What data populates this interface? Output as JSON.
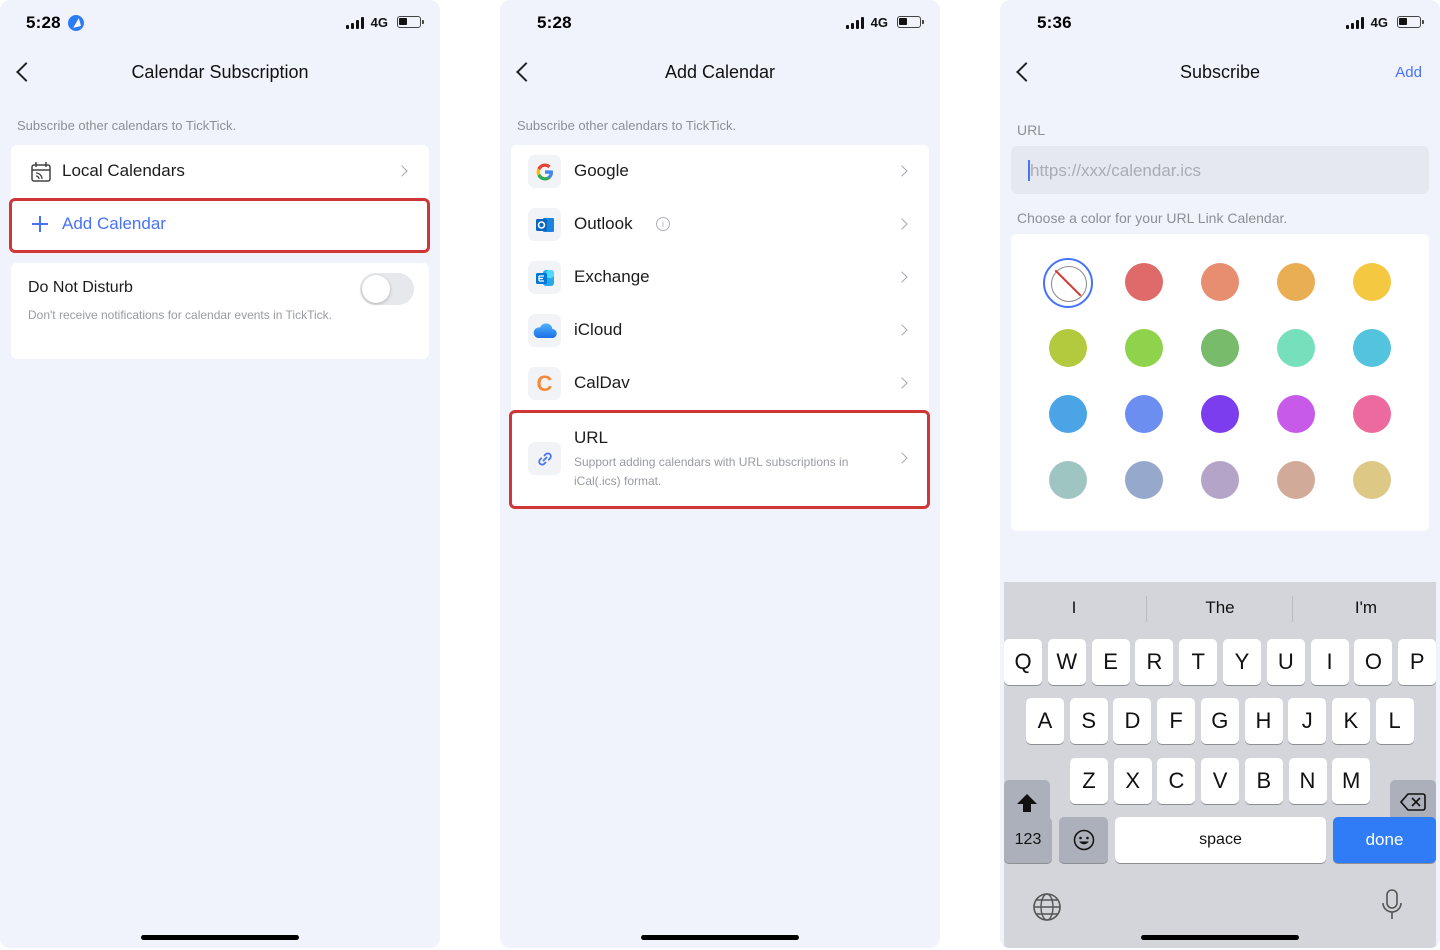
{
  "status": {
    "panel1_time": "5:28",
    "panel2_time": "5:28",
    "panel3_time": "5:36",
    "network": "4G"
  },
  "panel1": {
    "title": "Calendar Subscription",
    "hint": "Subscribe other calendars to TickTick.",
    "local_calendars": "Local Calendars",
    "add_calendar": "Add Calendar",
    "dnd_title": "Do Not Disturb",
    "dnd_desc": "Don't receive notifications for calendar events in TickTick."
  },
  "panel2": {
    "title": "Add Calendar",
    "hint": "Subscribe other calendars to TickTick.",
    "items": [
      {
        "label": "Google",
        "icon": "google-icon"
      },
      {
        "label": "Outlook",
        "icon": "outlook-icon"
      },
      {
        "label": "Exchange",
        "icon": "exchange-icon"
      },
      {
        "label": "iCloud",
        "icon": "icloud-icon"
      },
      {
        "label": "CalDav",
        "icon": "caldav-icon"
      }
    ],
    "url_title": "URL",
    "url_desc": "Support adding calendars with URL subscriptions in iCal(.ics) format."
  },
  "panel3": {
    "title": "Subscribe",
    "add_action": "Add",
    "url_label": "URL",
    "url_placeholder": "https://xxx/calendar.ics",
    "color_hint": "Choose a color for your URL Link Calendar.",
    "colors": [
      "#df6a6a",
      "#e88e70",
      "#e9ad54",
      "#f5c842",
      "#b3c93e",
      "#8fd24b",
      "#77bb6b",
      "#76e0bd",
      "#54c3dd",
      "#4aa4e6",
      "#6b8ef0",
      "#7b3dee",
      "#c75ae8",
      "#ec6a9e",
      "#9fc5c2",
      "#96a8cb",
      "#b3a4c8",
      "#d2aa9a",
      "#ddc985"
    ]
  },
  "keyboard": {
    "suggestions": [
      "I",
      "The",
      "I'm"
    ],
    "row1": [
      "Q",
      "W",
      "E",
      "R",
      "T",
      "Y",
      "U",
      "I",
      "O",
      "P"
    ],
    "row2": [
      "A",
      "S",
      "D",
      "F",
      "G",
      "H",
      "J",
      "K",
      "L"
    ],
    "row3": [
      "Z",
      "X",
      "C",
      "V",
      "B",
      "N",
      "M"
    ],
    "numbers_key": "123",
    "space_key": "space",
    "done_key": "done"
  },
  "colors": {
    "accent": "#4772fa",
    "highlight": "#cf3737",
    "background": "#f1f3fc"
  }
}
